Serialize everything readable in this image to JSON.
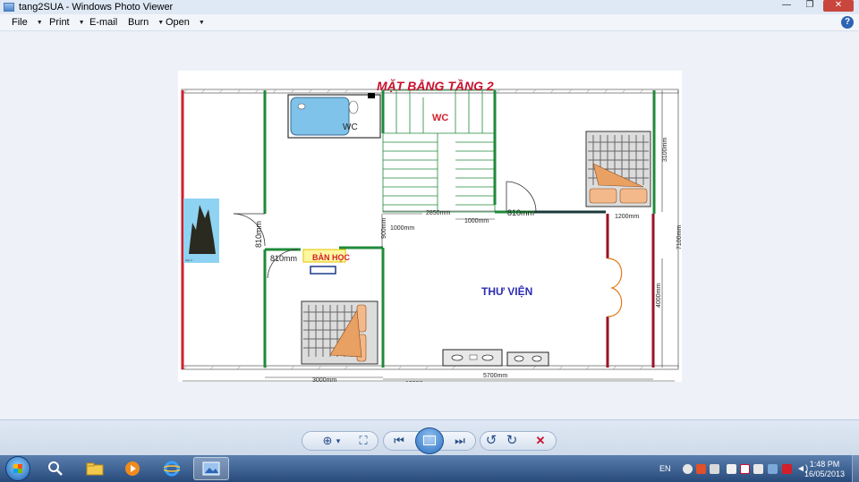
{
  "window": {
    "title": "tang2SUA - Windows Photo Viewer",
    "minimize_glyph": "—",
    "maximize_glyph": "❐",
    "close_glyph": "✕"
  },
  "menu": {
    "items": [
      {
        "label": "File",
        "has_arrow": true
      },
      {
        "label": "Print",
        "has_arrow": true
      },
      {
        "label": "E-mail",
        "has_arrow": false
      },
      {
        "label": "Burn",
        "has_arrow": true
      },
      {
        "label": "Open",
        "has_arrow": true
      }
    ],
    "arrow_glyph": "▼",
    "help_glyph": "?"
  },
  "floor_plan": {
    "title": "MẶT BẰNG TẦNG 2",
    "rooms": {
      "wc_label_red": "WC",
      "wc_label_tub": "WC",
      "study": "BÀN HỌC",
      "library": "THƯ VIỆN"
    },
    "dimensions": {
      "d_810_vertical_left": "810mm",
      "d_810_left": "810mm",
      "d_900_vertical": "900mm",
      "d_1000_left": "1000mm",
      "d_2850": "2850mm",
      "d_1000_right": "1000mm",
      "d_810_right": "810mm",
      "d_1200": "1200mm",
      "d_3100": "3100mm",
      "d_7100": "7100mm",
      "d_4000": "4000mm",
      "d_3000": "3000mm",
      "d_12000": "12000mm",
      "d_5700": "5700mm"
    },
    "picture_caption": "http://..."
  },
  "controls": {
    "zoom_glyph": "⊕",
    "zoom_arrow": "▾",
    "fit_glyph": "⛶",
    "prev_glyph": "⏮",
    "next_glyph": "⏭",
    "rotate_ccw_glyph": "↺",
    "rotate_cw_glyph": "↻",
    "delete_glyph": "✕"
  },
  "taskbar": {
    "language": "EN",
    "time": "1:48 PM",
    "date": "16/05/2013"
  },
  "colors": {
    "wall_green": "#1f8a3a",
    "wall_red": "#d21f2b",
    "wall_darkred": "#9b1226",
    "title_red": "#c8102e",
    "library_blue": "#2c2cb4",
    "wall_hatch": "#888888"
  }
}
